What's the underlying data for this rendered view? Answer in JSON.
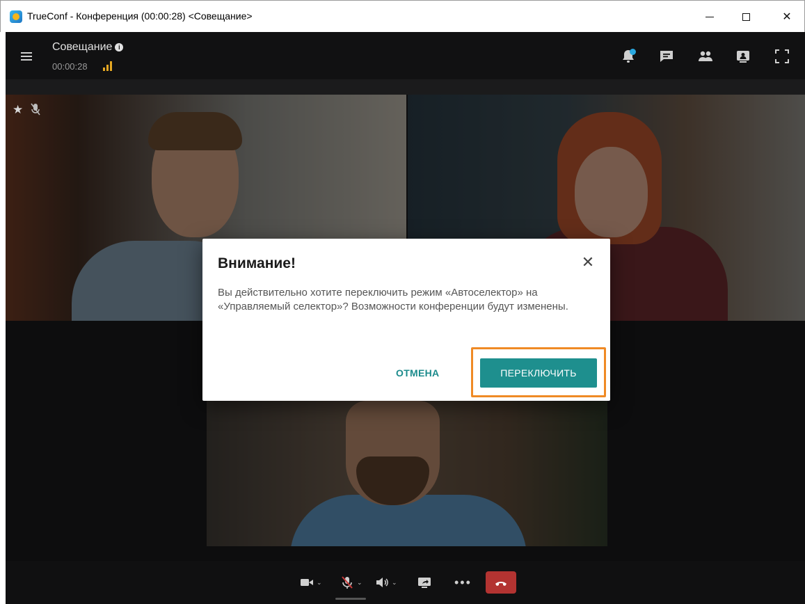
{
  "window": {
    "title": "TrueConf - Конференция (00:00:28) <Совещание>",
    "controls": [
      "minimize",
      "maximize",
      "close"
    ]
  },
  "header": {
    "conference_name": "Совещание",
    "timer": "00:00:28",
    "signal_bars_filled": 3,
    "icons": [
      "bell-notification-icon",
      "chat-icon",
      "participants-icon",
      "layout-icon",
      "fullscreen-icon"
    ]
  },
  "tiles": [
    {
      "participant": "participant-1",
      "starred": true,
      "mic_muted": true
    },
    {
      "participant": "participant-2",
      "starred": false,
      "mic_muted": false
    },
    {
      "participant": "participant-3",
      "starred": false,
      "mic_muted": false
    }
  ],
  "controls": {
    "items": [
      "camera",
      "microphone-muted",
      "speaker",
      "share-screen",
      "more",
      "hang-up"
    ]
  },
  "dialog": {
    "title": "Внимание!",
    "message": "Вы действительно хотите переключить режим «Автоселектор» на «Управляемый селектор»? Возможности конференции будут изменены.",
    "cancel_label": "ОТМЕНА",
    "confirm_label": "ПЕРЕКЛЮЧИТЬ",
    "close_glyph": "✕",
    "confirm_highlighted": true
  },
  "colors": {
    "accent": "#1e8f8e",
    "highlight": "#ef8a25",
    "hangup": "#b33331",
    "notification_dot": "#2aa8e0",
    "signal": "#e5a722"
  }
}
